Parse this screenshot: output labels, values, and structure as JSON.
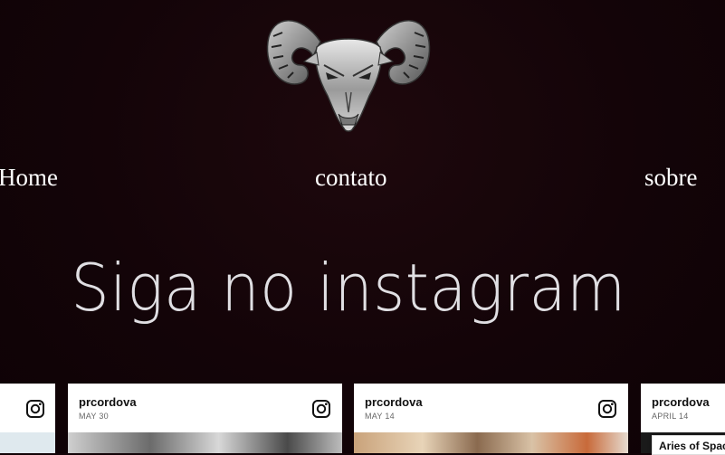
{
  "nav": {
    "home": "Home",
    "contato": "contato",
    "sobre": "sobre"
  },
  "headline": "Siga no instagram",
  "instagram_feed": [
    {
      "user": "",
      "date": ""
    },
    {
      "user": "prcordova",
      "date": "MAY 30"
    },
    {
      "user": "prcordova",
      "date": "MAY 14"
    },
    {
      "user": "prcordova",
      "date": "APRIL 14"
    }
  ],
  "tooltip": "Aries of Space",
  "icons": {
    "logo": "ram-head-logo",
    "instagram": "instagram-icon"
  },
  "colors": {
    "background": "#120307",
    "text": "#ffffff",
    "card": "#ffffff"
  }
}
